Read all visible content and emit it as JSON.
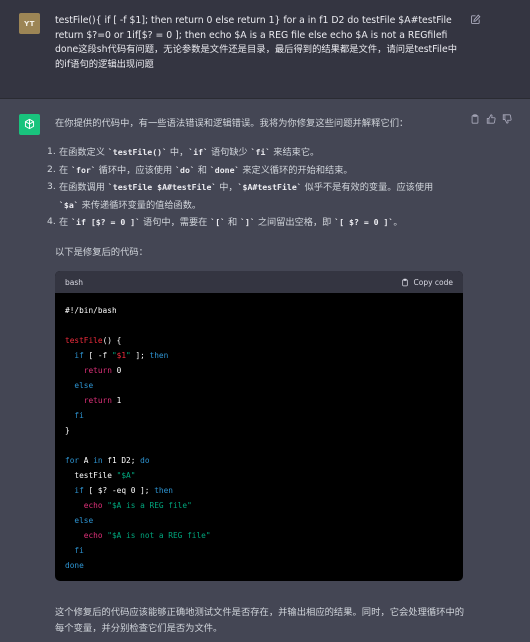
{
  "user": {
    "avatar_initials": "YT",
    "message": "testFile(){ if [ -f $1]; then  return 0  else  return 1}    for a in f1 D2  do  testFile $A#testFile return $?=0 or 1if[$? = 0 ]; then  echo $A is a REG file else  echo $A is not a REGfilefi  done这段sh代码有问题，无论参数是文件还是目录，最后得到的结果都是文件，请问是testFile中的if语句的逻辑出现问题"
  },
  "assistant": {
    "intro": "在你提供的代码中，有一些语法错误和逻辑错误。我将为你修复这些问题并解释它们：",
    "points": [
      {
        "num": "1.",
        "parts": [
          {
            "t": "在函数定义 "
          },
          {
            "c": "`testFile()`"
          },
          {
            "t": " 中，"
          },
          {
            "c": "`if`"
          },
          {
            "t": " 语句缺少 "
          },
          {
            "c": "`fi`"
          },
          {
            "t": " 来结束它。"
          }
        ]
      },
      {
        "num": "2.",
        "parts": [
          {
            "t": "在 "
          },
          {
            "c": "`for`"
          },
          {
            "t": " 循环中，应该使用 "
          },
          {
            "c": "`do`"
          },
          {
            "t": " 和 "
          },
          {
            "c": "`done`"
          },
          {
            "t": " 来定义循环的开始和结束。"
          }
        ]
      },
      {
        "num": "3.",
        "parts": [
          {
            "t": "在函数调用 "
          },
          {
            "c": "`testFile $A#testFile`"
          },
          {
            "t": " 中，"
          },
          {
            "c": "`$A#testFile`"
          },
          {
            "t": " 似乎不是有效的变量。应该使用"
          },
          {
            "br": true
          },
          {
            "c": "`$a`"
          },
          {
            "t": " 来传递循环变量的值给函数。"
          }
        ]
      },
      {
        "num": "4.",
        "parts": [
          {
            "t": "在 "
          },
          {
            "c": "`if [$? = 0 ]`"
          },
          {
            "t": " 语句中，需要在 "
          },
          {
            "c": "`[`"
          },
          {
            "t": " 和 "
          },
          {
            "c": "`]`"
          },
          {
            "t": " 之间留出空格，即 "
          },
          {
            "c": "`[ $? = 0 ]`"
          },
          {
            "t": "。"
          }
        ]
      }
    ],
    "fixed_label": "以下是修复后的代码：",
    "code_lang": "bash",
    "copy_label": "Copy code",
    "code_lines": [
      [
        {
          "s": "#!/bin/bash"
        }
      ],
      [],
      [
        {
          "s": "testFile",
          "c": "t-fn"
        },
        {
          "s": "() {"
        }
      ],
      [
        {
          "s": "  "
        },
        {
          "s": "if",
          "c": "t-kw"
        },
        {
          "s": " [ -f "
        },
        {
          "s": "\"",
          "c": "t-str"
        },
        {
          "s": "$1",
          "c": "t-var"
        },
        {
          "s": "\"",
          "c": "t-str"
        },
        {
          "s": " ]; "
        },
        {
          "s": "then",
          "c": "t-kw"
        }
      ],
      [
        {
          "s": "    "
        },
        {
          "s": "return",
          "c": "t-ret"
        },
        {
          "s": " 0"
        }
      ],
      [
        {
          "s": "  "
        },
        {
          "s": "else",
          "c": "t-kw"
        }
      ],
      [
        {
          "s": "    "
        },
        {
          "s": "return",
          "c": "t-ret"
        },
        {
          "s": " 1"
        }
      ],
      [
        {
          "s": "  "
        },
        {
          "s": "fi",
          "c": "t-kw"
        }
      ],
      [
        {
          "s": "}"
        }
      ],
      [],
      [
        {
          "s": "for",
          "c": "t-kw"
        },
        {
          "s": " A "
        },
        {
          "s": "in",
          "c": "t-kw"
        },
        {
          "s": " f1 D2; "
        },
        {
          "s": "do",
          "c": "t-kw"
        }
      ],
      [
        {
          "s": "  testFile "
        },
        {
          "s": "\"$A\"",
          "c": "t-str"
        }
      ],
      [
        {
          "s": "  "
        },
        {
          "s": "if",
          "c": "t-kw"
        },
        {
          "s": " [ $? -eq 0 ]; "
        },
        {
          "s": "then",
          "c": "t-kw"
        }
      ],
      [
        {
          "s": "    "
        },
        {
          "s": "echo",
          "c": "t-ret"
        },
        {
          "s": " "
        },
        {
          "s": "\"$A is a REG file\"",
          "c": "t-str"
        }
      ],
      [
        {
          "s": "  "
        },
        {
          "s": "else",
          "c": "t-kw"
        }
      ],
      [
        {
          "s": "    "
        },
        {
          "s": "echo",
          "c": "t-ret"
        },
        {
          "s": " "
        },
        {
          "s": "\"$A is not a REG file\"",
          "c": "t-str"
        }
      ],
      [
        {
          "s": "  "
        },
        {
          "s": "fi",
          "c": "t-kw"
        }
      ],
      [
        {
          "s": "done",
          "c": "t-kw"
        }
      ]
    ],
    "outro": "这个修复后的代码应该能够正确地测试文件是否存在，并输出相应的结果。同时，它会处理循环中的每个变量，并分别检查它们是否为文件。"
  },
  "icons": {
    "edit": "edit-icon",
    "copy": "clipboard-icon",
    "thumbs_up": "thumbs-up-icon",
    "thumbs_down": "thumbs-down-icon",
    "openai_logo": "openai-logo-icon"
  },
  "colors": {
    "user_bg": "#343541",
    "assistant_bg": "#444654",
    "gpt_avatar": "#19c37d",
    "user_avatar": "#9c8555",
    "code_bg": "#000000"
  }
}
